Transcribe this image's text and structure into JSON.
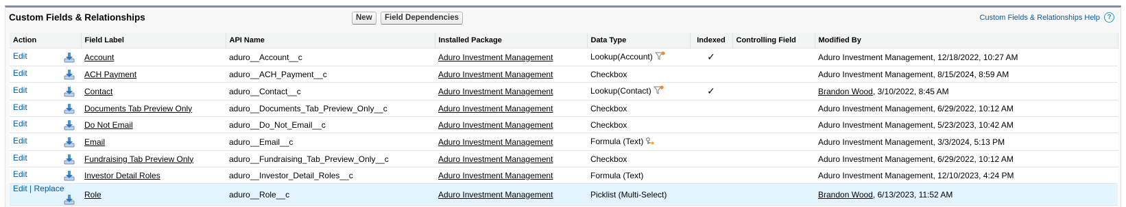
{
  "panel": {
    "title": "Custom Fields & Relationships",
    "new_label": "New",
    "field_dependencies_label": "Field Dependencies",
    "help_label": "Custom Fields & Relationships Help",
    "help_icon_glyph": "?"
  },
  "columns": {
    "action": "Action",
    "field_label": "Field Label",
    "api_name": "API Name",
    "installed_package": "Installed Package",
    "data_type": "Data Type",
    "indexed": "Indexed",
    "controlling_field": "Controlling Field",
    "modified_by": "Modified By"
  },
  "colors": {
    "link_blue": "#015ba7",
    "header_bg": "#f2f3f3",
    "highlight_row": "#e3f3ff",
    "panel_border": "#7e8ba3"
  },
  "rows": [
    {
      "edit": "Edit",
      "replace": "",
      "icon": "download-icon",
      "field_label": "Account",
      "api_name": "aduro__Account__c",
      "installed_package": "Aduro Investment Management",
      "data_type": "Lookup(Account)",
      "data_type_icon": "lookup-filter-icon",
      "indexed": "✓",
      "controlling_field": "",
      "modified_by_name": "Aduro Investment Management",
      "modified_by_name_linked": false,
      "modified_date": ", 12/18/2022, 10:27 AM"
    },
    {
      "edit": "Edit",
      "replace": "",
      "icon": "download-icon",
      "field_label": "ACH Payment",
      "api_name": "aduro__ACH_Payment__c",
      "installed_package": "Aduro Investment Management",
      "data_type": "Checkbox",
      "data_type_icon": "",
      "indexed": "",
      "controlling_field": "",
      "modified_by_name": "Aduro Investment Management",
      "modified_by_name_linked": false,
      "modified_date": ", 8/15/2024, 8:59 AM"
    },
    {
      "edit": "Edit",
      "replace": "",
      "icon": "download-icon",
      "field_label": "Contact",
      "api_name": "aduro__Contact__c",
      "installed_package": "Aduro Investment Management",
      "data_type": "Lookup(Contact)",
      "data_type_icon": "lookup-filter-icon",
      "indexed": "✓",
      "controlling_field": "",
      "modified_by_name": "Brandon Wood",
      "modified_by_name_linked": true,
      "modified_date": ", 3/10/2022, 8:45 AM"
    },
    {
      "edit": "Edit",
      "replace": "",
      "icon": "download-icon",
      "field_label": "Documents Tab Preview Only",
      "api_name": "aduro__Documents_Tab_Preview_Only__c",
      "installed_package": "Aduro Investment Management",
      "data_type": "Checkbox",
      "data_type_icon": "",
      "indexed": "",
      "controlling_field": "",
      "modified_by_name": "Aduro Investment Management",
      "modified_by_name_linked": false,
      "modified_date": ", 6/29/2022, 10:12 AM"
    },
    {
      "edit": "Edit",
      "replace": "",
      "icon": "download-icon",
      "field_label": "Do Not Email",
      "api_name": "aduro__Do_Not_Email__c",
      "installed_package": "Aduro Investment Management",
      "data_type": "Checkbox",
      "data_type_icon": "",
      "indexed": "",
      "controlling_field": "",
      "modified_by_name": "Aduro Investment Management",
      "modified_by_name_linked": false,
      "modified_date": ", 5/23/2023, 10:42 AM"
    },
    {
      "edit": "Edit",
      "replace": "",
      "icon": "download-icon",
      "field_label": "Email",
      "api_name": "aduro__Email__c",
      "installed_package": "Aduro Investment Management",
      "data_type": "Formula (Text)",
      "data_type_icon": "formula-icon",
      "indexed": "",
      "controlling_field": "",
      "modified_by_name": "Aduro Investment Management",
      "modified_by_name_linked": false,
      "modified_date": ", 3/3/2024, 5:13 PM"
    },
    {
      "edit": "Edit",
      "replace": "",
      "icon": "download-icon",
      "field_label": "Fundraising Tab Preview Only",
      "api_name": "aduro__Fundraising_Tab_Preview_Only__c",
      "installed_package": "Aduro Investment Management",
      "data_type": "Checkbox",
      "data_type_icon": "",
      "indexed": "",
      "controlling_field": "",
      "modified_by_name": "Aduro Investment Management",
      "modified_by_name_linked": false,
      "modified_date": ", 6/29/2022, 10:12 AM"
    },
    {
      "edit": "Edit",
      "replace": "",
      "icon": "download-icon",
      "field_label": "Investor Detail Roles",
      "api_name": "aduro__Investor_Detail_Roles__c",
      "installed_package": "Aduro Investment Management",
      "data_type": "Formula (Text)",
      "data_type_icon": "",
      "indexed": "",
      "controlling_field": "",
      "modified_by_name": "Aduro Investment Management",
      "modified_by_name_linked": false,
      "modified_date": ", 12/10/2023, 4:24 PM"
    },
    {
      "edit": "Edit",
      "replace": "Replace",
      "icon": "download-icon",
      "field_label": "Role",
      "api_name": "aduro__Role__c",
      "installed_package": "Aduro Investment Management",
      "data_type": "Picklist (Multi-Select)",
      "data_type_icon": "",
      "indexed": "",
      "controlling_field": "",
      "modified_by_name": "Brandon Wood",
      "modified_by_name_linked": true,
      "modified_date": ", 6/13/2023, 11:52 AM",
      "highlighted": true
    }
  ]
}
